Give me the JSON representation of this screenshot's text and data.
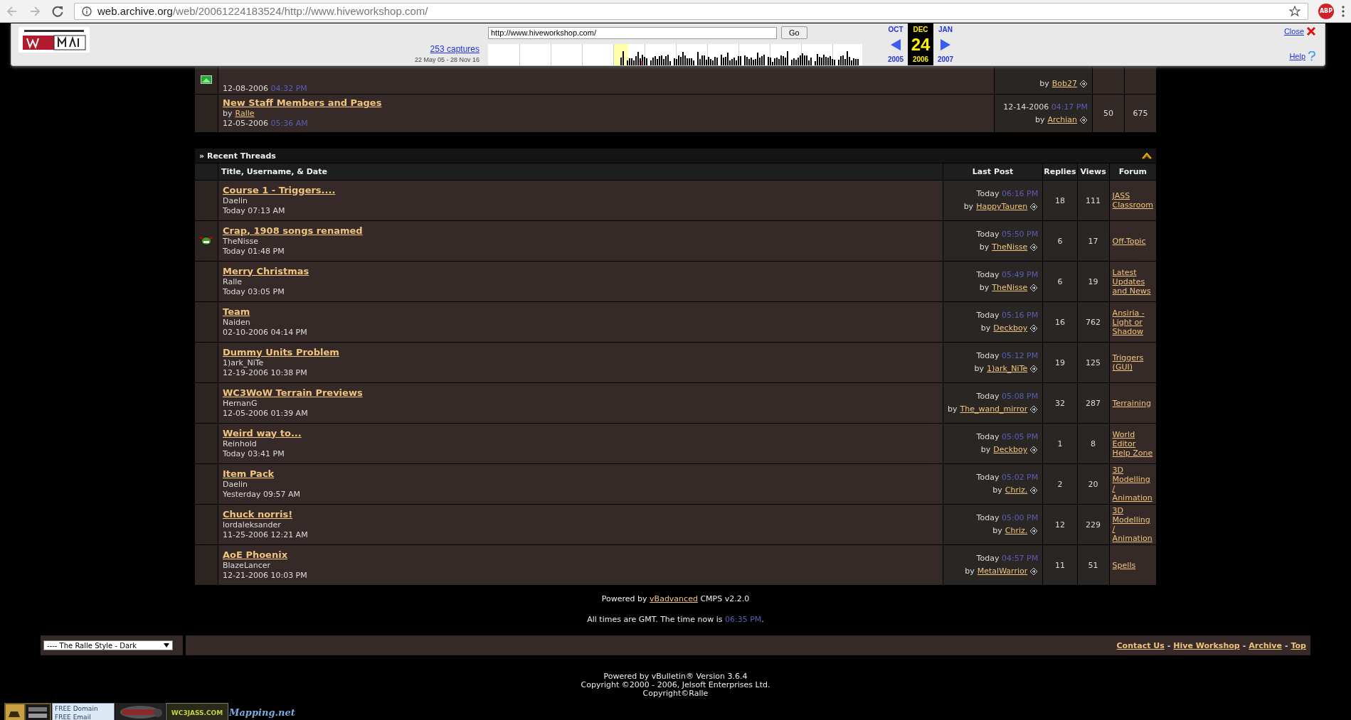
{
  "browser": {
    "url_host": "web.archive.org",
    "url_path": "/web/20061224183524/http://www.hiveworkshop.com/",
    "adblock": "ABP"
  },
  "wayback": {
    "captures": "253 captures",
    "range": "22 May 05 - 28 Nov 16",
    "url": "http://www.hiveworkshop.com/",
    "go": "Go",
    "prev_month": "OCT",
    "month": "DEC",
    "next_month": "JAN",
    "day": "24",
    "prev_year": "2005",
    "year": "2006",
    "next_year": "2007",
    "close": "Close",
    "help": "Help"
  },
  "forum_rows": [
    {
      "kind": "partial",
      "date": "12-08-2006",
      "time": "04:32 PM",
      "by": "by",
      "poster": "Bob27"
    },
    {
      "kind": "full",
      "title": "New Staff Members and Pages",
      "by": "by",
      "author": "Ralle",
      "date": "12-05-2006",
      "time": "05:36 AM",
      "last_date": "12-14-2006",
      "last_time": "04:17 PM",
      "last_by": "by",
      "last_poster": "Archian",
      "replies": "50",
      "views": "675"
    }
  ],
  "recent_threads": {
    "title": "» Recent Threads",
    "columns": [
      "Title, Username, & Date",
      "Last Post",
      "Replies",
      "Views",
      "Forum"
    ],
    "rows": [
      {
        "has_icon": false,
        "title": "Course 1 - Triggers....",
        "author": "Daelin",
        "started": "Today 07:13 AM",
        "last_date": "Today",
        "last_time": "06:16 PM",
        "by": "by",
        "last_poster": "HappyTauren",
        "replies": "18",
        "views": "111",
        "forum": "JASS Classroom"
      },
      {
        "has_icon": true,
        "title": "Crap, 1908 songs renamed",
        "author": "TheNisse",
        "started": "Today 01:48 PM",
        "last_date": "Today",
        "last_time": "05:50 PM",
        "by": "by",
        "last_poster": "TheNisse",
        "replies": "6",
        "views": "17",
        "forum": "Off-Topic"
      },
      {
        "has_icon": false,
        "title": "Merry Christmas",
        "author": "Ralle",
        "started": "Today 03:05 PM",
        "last_date": "Today",
        "last_time": "05:49 PM",
        "by": "by",
        "last_poster": "TheNisse",
        "replies": "6",
        "views": "19",
        "forum": "Latest Updates and News"
      },
      {
        "has_icon": false,
        "title": "Team",
        "author": "Naiden",
        "started": "02-10-2006 04:14 PM",
        "last_date": "Today",
        "last_time": "05:16 PM",
        "by": "by",
        "last_poster": "Deckboy",
        "replies": "16",
        "views": "762",
        "forum": "Ansiria - Light or Shadow"
      },
      {
        "has_icon": false,
        "title": "Dummy Units Problem",
        "author": "1)ark_NiTe",
        "started": "12-19-2006 10:38 PM",
        "last_date": "Today",
        "last_time": "05:12 PM",
        "by": "by",
        "last_poster": "1)ark_NiTe",
        "replies": "19",
        "views": "125",
        "forum": "Triggers (GUI)"
      },
      {
        "has_icon": false,
        "title": "WC3WoW Terrain Previews",
        "author": "HernanG",
        "started": "12-05-2006 01:39 AM",
        "last_date": "Today",
        "last_time": "05:08 PM",
        "by": "by",
        "last_poster": "The_wand_mirror",
        "replies": "32",
        "views": "287",
        "forum": "Terraining"
      },
      {
        "has_icon": false,
        "title": "Weird way to...",
        "author": "Reinhold",
        "started": "Today 03:41 PM",
        "last_date": "Today",
        "last_time": "05:05 PM",
        "by": "by",
        "last_poster": "Deckboy",
        "replies": "1",
        "views": "8",
        "forum": "World Editor Help Zone"
      },
      {
        "has_icon": false,
        "title": "Item Pack",
        "author": "Daelin",
        "started": "Yesterday 09:57 AM",
        "last_date": "Today",
        "last_time": "05:02 PM",
        "by": "by",
        "last_poster": "Chriz.",
        "replies": "2",
        "views": "20",
        "forum": "3D Modelling / Animation"
      },
      {
        "has_icon": false,
        "title": "Chuck norris!",
        "author": "lordaleksander",
        "started": "11-25-2006 12:21 AM",
        "last_date": "Today",
        "last_time": "05:00 PM",
        "by": "by",
        "last_poster": "Chriz.",
        "replies": "12",
        "views": "229",
        "forum": "3D Modelling / Animation"
      },
      {
        "has_icon": false,
        "title": "AoE Phoenix",
        "author": "BlazeLancer",
        "started": "12-21-2006 10:03 PM",
        "last_date": "Today",
        "last_time": "04:57 PM",
        "by": "by",
        "last_poster": "MetalWarrior",
        "replies": "11",
        "views": "51",
        "forum": "Spells"
      }
    ]
  },
  "powered": {
    "before": "Powered by",
    "link": "vBadvanced",
    "after": "CMPS v2.2.0"
  },
  "time_note": {
    "text": "All times are GMT. The time now is",
    "time": "06:35 PM",
    "end": "."
  },
  "style_select": "---- The Ralle Style - Dark",
  "footer_links": [
    "Contact Us",
    "Hive Workshop",
    "Archive",
    "Top"
  ],
  "footer_separator": "-",
  "copyright": [
    "Powered by vBulletin® Version 3.6.4",
    "Copyright ©2000 - 2006, Jelsoft Enterprises Ltd.",
    "Copyright©Ralle"
  ],
  "banners": [
    {
      "kind": "picture"
    },
    {
      "kind": "domain",
      "lines": [
        "FREE Domain",
        "FREE Email"
      ]
    },
    {
      "kind": "picture"
    },
    {
      "kind": "jass",
      "text": "WC3JASS.COM"
    },
    {
      "kind": "mapping",
      "text": "Mapping.net"
    }
  ]
}
